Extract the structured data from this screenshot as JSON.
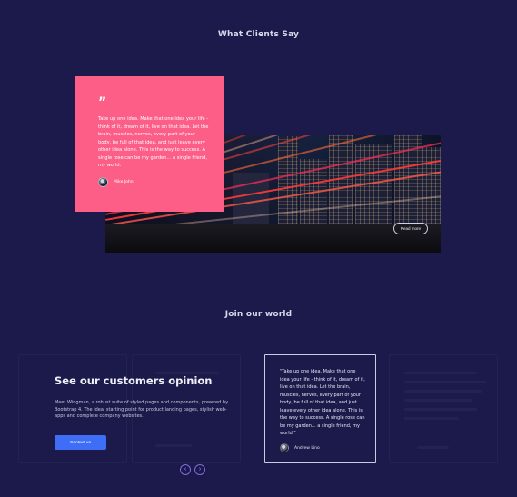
{
  "sections": {
    "clients": {
      "title": "What Clients Say"
    },
    "join": {
      "title": "Join our world"
    }
  },
  "featured_testimonial": {
    "quote_symbol": "”",
    "text": "Take up one idea. Make that one idea your life - think of it, dream of it, live on that idea. Let the brain, muscles, nerves, every part of your body, be full of that idea, and just leave every other idea alone. This is the way to success. A single rose can be my garden... a single friend, my world.",
    "author": "Mike John",
    "read_more_label": "Read more",
    "card_color": "#fc5e87"
  },
  "opinion": {
    "title": "See our customers opinion",
    "text": "Meet Wingman, a robust suite of styled pages and components, powered by Bootstrap 4. The ideal starting point for product landing pages, stylish web-apps and complete company websites.",
    "contact_label": "Contact us"
  },
  "slider_testimonial": {
    "text": "\"Take up one idea. Make that one idea your life - think of it, dream of it, live on that idea. Let the brain, muscles, nerves, every part of your body, be full of that idea, and just leave every other idea alone. This is the way to success. A single rose can be my garden... a single friend, my world.\"",
    "author": "Andrew Lino"
  },
  "slider_nav": {
    "prev": "‹",
    "next": "›"
  },
  "colors": {
    "background": "#1b1a4a",
    "accent_button": "#3e6ef5",
    "nav_ring": "#7f6bd9"
  },
  "icons": [
    "quote-icon",
    "avatar",
    "chevron-left-icon",
    "chevron-right-icon"
  ]
}
